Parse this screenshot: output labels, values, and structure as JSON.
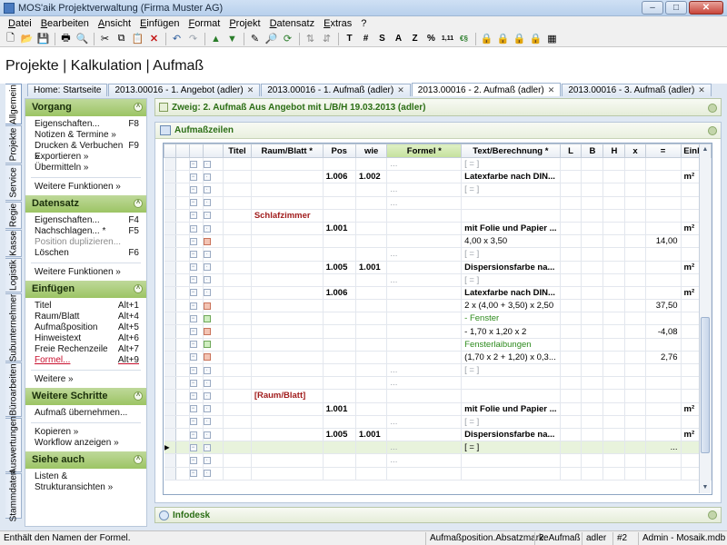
{
  "window": {
    "title": "MOS'aik Projektverwaltung (Firma Muster AG)"
  },
  "menu": [
    "Datei",
    "Bearbeiten",
    "Ansicht",
    "Einfügen",
    "Format",
    "Projekt",
    "Datensatz",
    "Extras",
    "?"
  ],
  "toolbar_text": [
    "T",
    "#",
    "S",
    "A",
    "Z",
    "%",
    "1,11",
    "€§"
  ],
  "page_title": "Projekte | Kalkulation | Aufmaß",
  "vertical_tabs": [
    "Allgemein",
    "Projekte",
    "Service",
    "Regie",
    "Kasse",
    "Logistik",
    "Subunternehmer",
    "Büroarbeiten",
    "Auswertungen",
    "Stammdaten"
  ],
  "doc_tabs": [
    {
      "label": "Home: Startseite",
      "closable": false
    },
    {
      "label": "2013.00016 - 1. Angebot (adler)",
      "closable": true
    },
    {
      "label": "2013.00016 - 1. Aufmaß (adler)",
      "closable": true
    },
    {
      "label": "2013.00016 - 2. Aufmaß (adler)",
      "closable": true
    },
    {
      "label": "2013.00016 - 3. Aufmaß (adler)",
      "closable": true
    }
  ],
  "sidebar": {
    "vorgang": {
      "title": "Vorgang",
      "items": [
        {
          "label": "Eigenschaften...",
          "key": "F8"
        },
        {
          "label": "Notizen & Termine »",
          "key": ""
        },
        {
          "label": "Drucken & Verbuchen »",
          "key": "F9"
        },
        {
          "label": "Exportieren »",
          "key": ""
        },
        {
          "label": "Übermitteln »",
          "key": ""
        }
      ],
      "more": "Weitere Funktionen »"
    },
    "datensatz": {
      "title": "Datensatz",
      "items": [
        {
          "label": "Eigenschaften...",
          "key": "F4"
        },
        {
          "label": "Nachschlagen... *",
          "key": "F5"
        },
        {
          "label": "Position duplizieren...",
          "key": ""
        },
        {
          "label": "Löschen",
          "key": "F6"
        }
      ],
      "more": "Weitere Funktionen »"
    },
    "einfuegen": {
      "title": "Einfügen",
      "items": [
        {
          "label": "Titel",
          "key": "Alt+1"
        },
        {
          "label": "Raum/Blatt",
          "key": "Alt+4"
        },
        {
          "label": "Aufmaßposition",
          "key": "Alt+5"
        },
        {
          "label": "Hinweistext",
          "key": "Alt+6"
        },
        {
          "label": "Freie Rechenzeile",
          "key": "Alt+7"
        },
        {
          "label": "Formel...",
          "key": "Alt+9"
        }
      ],
      "more": "Weitere »"
    },
    "schritte": {
      "title": "Weitere Schritte",
      "items": [
        "Aufmaß übernehmen...",
        "Kopieren »",
        "Workflow anzeigen »"
      ]
    },
    "siehe": {
      "title": "Siehe auch",
      "items": [
        "Listen & Strukturansichten »"
      ]
    }
  },
  "branch": "Zweig: 2. Aufmaß Aus Angebot mit L/B/H 19.03.2013 (adler)",
  "grid": {
    "title": "Aufmaßzeilen",
    "columns": [
      "Titel",
      "Raum/Blatt *",
      "Pos",
      "wie",
      "Formel *",
      "Text/Berechnung *",
      "L",
      "B",
      "H",
      "x",
      "=",
      "Einh *"
    ],
    "rows": [
      {
        "icon": "",
        "pos": "",
        "wie": "",
        "formel": "...",
        "text": "[ = ]",
        "eq": "",
        "einh": "",
        "style": "gray"
      },
      {
        "icon": "",
        "pos": "1.006",
        "wie": "1.002",
        "formel": "",
        "text": "Latexfarbe nach DIN...",
        "eq": "",
        "einh": "m²",
        "style": "bold"
      },
      {
        "icon": "",
        "pos": "",
        "wie": "",
        "formel": "...",
        "text": "[ = ]",
        "eq": "",
        "einh": "",
        "style": "gray"
      },
      {
        "icon": "",
        "pos": "",
        "wie": "",
        "formel": "...",
        "text": "",
        "eq": "",
        "einh": "",
        "style": "gray"
      },
      {
        "icon": "",
        "raum": "Schlafzimmer",
        "pos": "",
        "wie": "",
        "formel": "",
        "text": "",
        "eq": "",
        "einh": "",
        "style": "raum"
      },
      {
        "icon": "",
        "pos": "1.001",
        "wie": "",
        "formel": "",
        "text": "mit Folie und Papier ...",
        "eq": "",
        "einh": "m²",
        "style": "bold"
      },
      {
        "icon": "r",
        "pos": "",
        "wie": "",
        "formel": "",
        "text": "4,00 x 3,50",
        "eq": "14,00",
        "einh": "",
        "style": "normal"
      },
      {
        "icon": "",
        "pos": "",
        "wie": "",
        "formel": "...",
        "text": "[ = ]",
        "eq": "",
        "einh": "",
        "style": "gray"
      },
      {
        "icon": "",
        "pos": "1.005",
        "wie": "1.001",
        "formel": "",
        "text": "Dispersionsfarbe na...",
        "eq": "",
        "einh": "m²",
        "style": "bold"
      },
      {
        "icon": "",
        "pos": "",
        "wie": "",
        "formel": "...",
        "text": "[ = ]",
        "eq": "",
        "einh": "",
        "style": "gray"
      },
      {
        "icon": "",
        "pos": "1.006",
        "wie": "",
        "formel": "",
        "text": "Latexfarbe nach DIN...",
        "eq": "",
        "einh": "m²",
        "style": "bold"
      },
      {
        "icon": "r",
        "pos": "",
        "wie": "",
        "formel": "",
        "text": "2 x (4,00 + 3,50) x 2,50",
        "eq": "37,50",
        "einh": "",
        "style": "normal"
      },
      {
        "icon": "g",
        "pos": "",
        "wie": "",
        "formel": "",
        "text": "- Fenster",
        "eq": "",
        "einh": "",
        "style": "green"
      },
      {
        "icon": "r",
        "pos": "",
        "wie": "",
        "formel": "",
        "text": "- 1,70 x 1,20 x 2",
        "eq": "-4,08",
        "einh": "",
        "style": "normal"
      },
      {
        "icon": "g",
        "pos": "",
        "wie": "",
        "formel": "",
        "text": "Fensterlaibungen",
        "eq": "",
        "einh": "",
        "style": "green"
      },
      {
        "icon": "r",
        "pos": "",
        "wie": "",
        "formel": "",
        "text": "(1,70 x 2 + 1,20) x 0,3...",
        "eq": "2,76",
        "einh": "",
        "style": "normal"
      },
      {
        "icon": "",
        "pos": "",
        "wie": "",
        "formel": "...",
        "text": "[ = ]",
        "eq": "",
        "einh": "",
        "style": "gray"
      },
      {
        "icon": "",
        "pos": "",
        "wie": "",
        "formel": "...",
        "text": "",
        "eq": "",
        "einh": "",
        "style": "gray"
      },
      {
        "icon": "",
        "raum": "[Raum/Blatt]",
        "pos": "",
        "wie": "",
        "formel": "",
        "text": "",
        "eq": "",
        "einh": "",
        "style": "raum"
      },
      {
        "icon": "",
        "pos": "1.001",
        "wie": "",
        "formel": "",
        "text": "mit Folie und Papier ...",
        "eq": "",
        "einh": "m²",
        "style": "bold"
      },
      {
        "icon": "",
        "pos": "",
        "wie": "",
        "formel": "...",
        "text": "[ = ]",
        "eq": "",
        "einh": "",
        "style": "gray"
      },
      {
        "icon": "",
        "pos": "1.005",
        "wie": "1.001",
        "formel": "",
        "text": "Dispersionsfarbe na...",
        "eq": "",
        "einh": "m²",
        "style": "bold"
      },
      {
        "icon": "",
        "pos": "",
        "wie": "",
        "formel": "...",
        "text": "[ = ]",
        "eq": "...",
        "einh": "",
        "style": "current"
      },
      {
        "icon": "",
        "pos": "",
        "wie": "",
        "formel": "...",
        "text": "",
        "eq": "",
        "einh": "",
        "style": "gray"
      },
      {
        "icon": "",
        "pos": "",
        "wie": "",
        "formel": "",
        "text": "",
        "eq": "",
        "einh": "",
        "style": "gray"
      }
    ]
  },
  "infodesk": "Infodesk",
  "status": {
    "message": "Enthält den Namen der Formel.",
    "field": "Aufmaßposition.Absatzmarke",
    "doc": "2. Aufmaß",
    "user": "adler",
    "num": "#2",
    "db": "Admin - Mosaik.mdb"
  }
}
